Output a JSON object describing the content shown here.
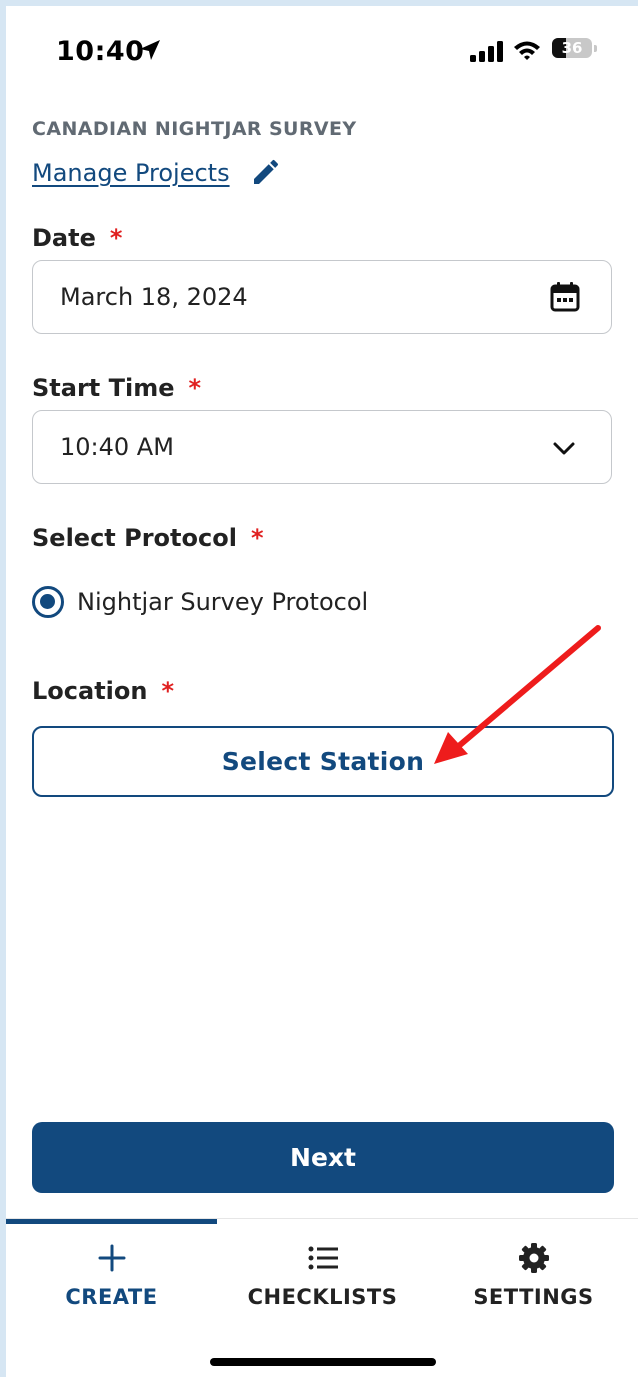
{
  "status_bar": {
    "time": "10:40",
    "battery_level": "36",
    "battery_fraction": 0.36
  },
  "project": {
    "name": "CANADIAN NIGHTJAR SURVEY",
    "manage_link": "Manage Projects"
  },
  "form": {
    "date": {
      "label": "Date",
      "required_mark": "*",
      "value": "March 18, 2024"
    },
    "start_time": {
      "label": "Start Time",
      "required_mark": "*",
      "value": "10:40 AM"
    },
    "protocol": {
      "label": "Select Protocol",
      "required_mark": "*",
      "option": "Nightjar Survey Protocol",
      "selected": true
    },
    "location": {
      "label": "Location",
      "required_mark": "*",
      "button": "Select Station"
    }
  },
  "next_button": "Next",
  "tabs": [
    {
      "label": "CREATE",
      "icon": "plus-icon",
      "active": true
    },
    {
      "label": "CHECKLISTS",
      "icon": "list-icon",
      "active": false
    },
    {
      "label": "SETTINGS",
      "icon": "gear-icon",
      "active": false
    }
  ],
  "colors": {
    "accent": "#12497e",
    "required": "#e02020",
    "annotation_arrow": "#ee1c1c",
    "page_border": "#d6e6f3"
  }
}
